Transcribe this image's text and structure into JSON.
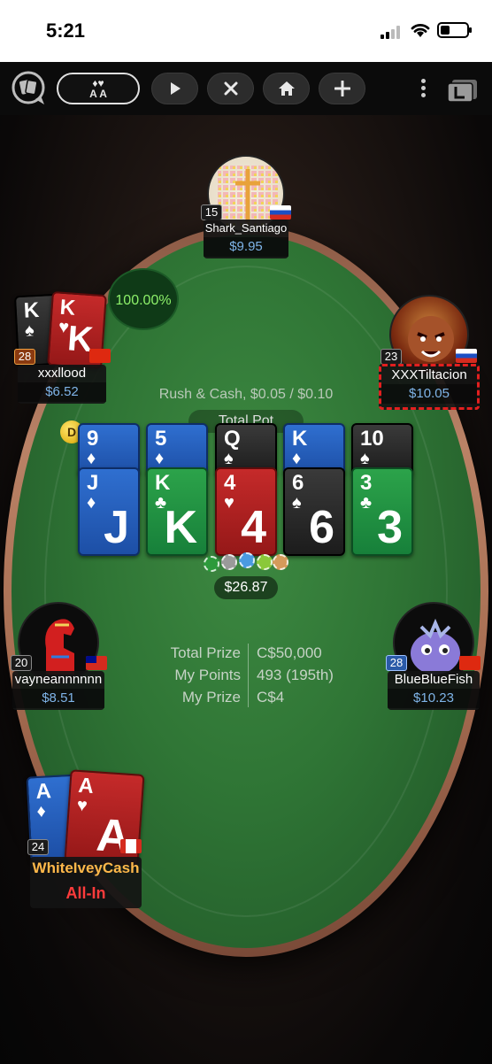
{
  "status_bar": {
    "time": "5:21"
  },
  "toolbar": {
    "hand_button_suits": "♦♥",
    "hand_button_ranks": "A A",
    "icons": [
      "chat-icon",
      "play-icon",
      "close-icon",
      "home-icon",
      "plus-icon",
      "more-icon",
      "layout-icon"
    ]
  },
  "table": {
    "game_info": "Rush & Cash, $0.05 / $0.10",
    "total_pot_label": "Total Pot",
    "dealer_label": "D",
    "pot_amount": "$26.87"
  },
  "board": {
    "run1": [
      {
        "rank": "9",
        "suit": "♦",
        "color": "blue"
      },
      {
        "rank": "5",
        "suit": "♦",
        "color": "blue"
      },
      {
        "rank": "Q",
        "suit": "♠",
        "color": "black"
      },
      {
        "rank": "K",
        "suit": "♦",
        "color": "blue"
      },
      {
        "rank": "10",
        "suit": "♠",
        "color": "black"
      }
    ],
    "run2": [
      {
        "rank": "J",
        "suit": "♦",
        "color": "blue"
      },
      {
        "rank": "K",
        "suit": "♣",
        "color": "green"
      },
      {
        "rank": "4",
        "suit": "♥",
        "color": "red"
      },
      {
        "rank": "6",
        "suit": "♠",
        "color": "black"
      },
      {
        "rank": "3",
        "suit": "♣",
        "color": "green"
      }
    ]
  },
  "players": {
    "top": {
      "name": "Shark_Santiago",
      "stack": "$9.95",
      "level": "15",
      "flag": "russia"
    },
    "left_upper": {
      "name": "xxxllood",
      "stack": "$6.52",
      "level": "28",
      "flag": "china",
      "cards": [
        {
          "rank": "K",
          "suit": "♠"
        },
        {
          "rank": "K",
          "suit": "♥"
        }
      ],
      "equity": "100.00%"
    },
    "right_upper": {
      "name": "XXXTiltacion",
      "stack": "$10.05",
      "level": "23",
      "flag": "russia"
    },
    "left_middle": {
      "name": "vayneannnnnn",
      "stack": "$8.51",
      "level": "20",
      "flag": "taiwan"
    },
    "right_middle": {
      "name": "BlueBlueFish",
      "stack": "$10.23",
      "level": "28",
      "flag": "china"
    },
    "hero": {
      "name": "WhiteIveyCash",
      "status": "All-In",
      "level": "24",
      "flag": "canada",
      "cards": [
        {
          "rank": "A",
          "suit": "♦"
        },
        {
          "rank": "A",
          "suit": "♥"
        }
      ]
    }
  },
  "prize": {
    "rows": [
      {
        "label": "Total Prize",
        "value": "C$50,000"
      },
      {
        "label": "My Points",
        "value": "493 (195th)"
      },
      {
        "label": "My Prize",
        "value": "C$4"
      }
    ]
  },
  "colors": {
    "felt": "#2f7535",
    "rail": "#b98266",
    "stack": "#7fb4e8",
    "allin": "#ff3b3b",
    "equity": "#8df06a"
  }
}
